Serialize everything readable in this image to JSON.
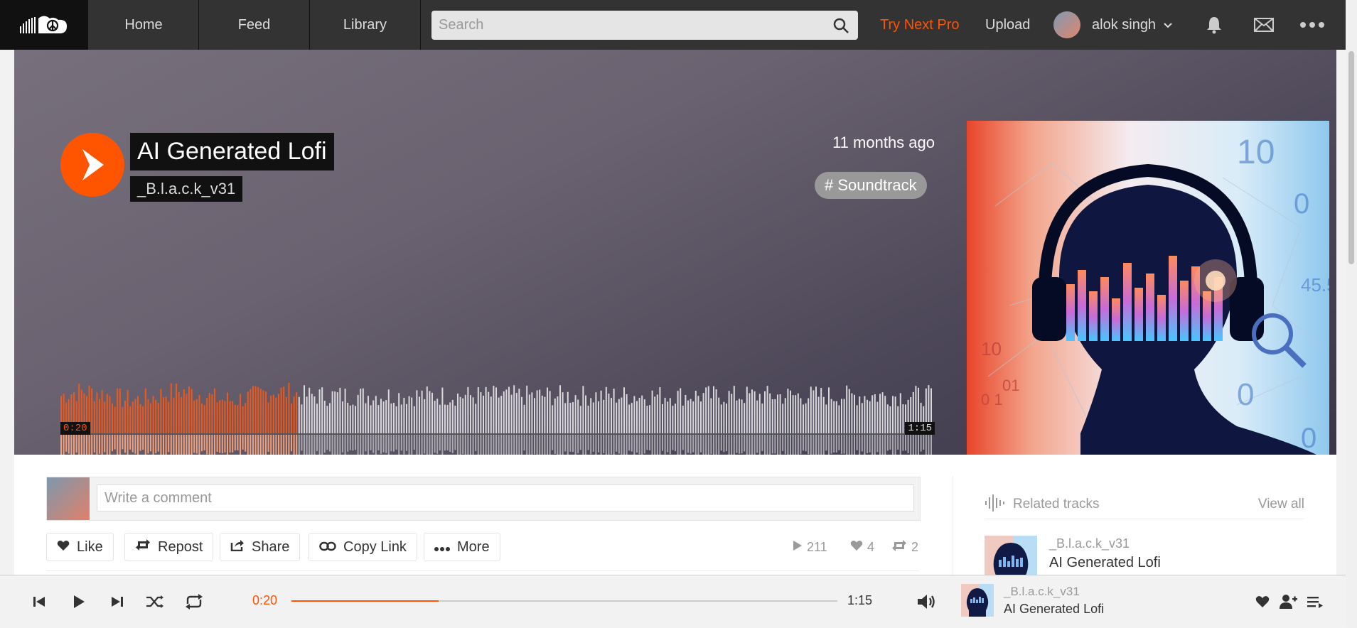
{
  "nav": {
    "items": [
      {
        "label": "Home"
      },
      {
        "label": "Feed"
      },
      {
        "label": "Library"
      }
    ],
    "search_placeholder": "Search",
    "try_pro": "Try Next Pro",
    "upload": "Upload",
    "username": "alok singh",
    "icons": [
      "soundcloud-logo-icon",
      "search-icon",
      "chevron-down-icon",
      "bell-icon",
      "mail-icon",
      "more-dots-icon"
    ]
  },
  "track": {
    "title": "AI Generated Lofi",
    "artist": "_B.l.a.c.k_v31",
    "posted": "11 months ago",
    "tag": "# Soundtrack",
    "elapsed": "0:20",
    "duration": "1:15",
    "progress_fraction": 0.27
  },
  "comment": {
    "placeholder": "Write a comment"
  },
  "actions": {
    "like": "Like",
    "repost": "Repost",
    "share": "Share",
    "copy_link": "Copy Link",
    "more": "More"
  },
  "stats": {
    "plays": "211",
    "likes": "4",
    "reposts": "2"
  },
  "related": {
    "heading": "Related tracks",
    "view_all": "View all",
    "items": [
      {
        "artist": "_B.l.a.c.k_v31",
        "title": "AI Generated Lofi"
      }
    ]
  },
  "player": {
    "elapsed": "0:20",
    "duration": "1:15",
    "progress_fraction": 0.27,
    "artist": "_B.l.a.c.k_v31",
    "title": "AI Generated Lofi"
  },
  "colors": {
    "accent": "#ff5500",
    "played_wave": "#f0581a",
    "unplayed_wave": "#d9d9dc"
  }
}
